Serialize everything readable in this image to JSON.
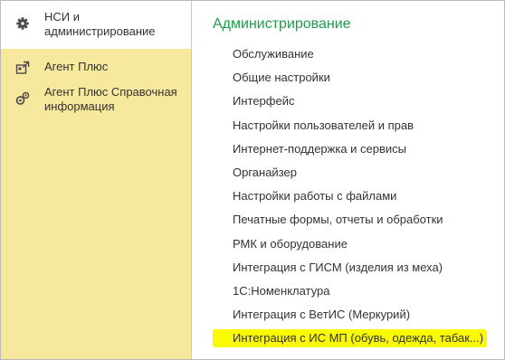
{
  "sidebar": {
    "items": [
      {
        "label": "НСИ и\nадминистрирование",
        "line1": "НСИ и",
        "line2": "администрирование",
        "icon": "gear-icon",
        "active": true
      },
      {
        "label": "Агент Плюс",
        "icon": "agent-plus-icon",
        "active": false
      },
      {
        "label": "Агент Плюс Справочная информация",
        "line1": "Агент Плюс Справочная",
        "line2": "информация",
        "icon": "agent-plus-reference-icon",
        "active": false
      }
    ]
  },
  "main": {
    "section_title": "Администрирование",
    "links": [
      {
        "label": "Обслуживание"
      },
      {
        "label": "Общие настройки"
      },
      {
        "label": "Интерфейс"
      },
      {
        "label": "Настройки пользователей и прав"
      },
      {
        "label": "Интернет-поддержка и сервисы"
      },
      {
        "label": "Органайзер"
      },
      {
        "label": "Настройки работы с файлами"
      },
      {
        "label": "Печатные формы, отчеты и обработки"
      },
      {
        "label": "РМК и оборудование"
      },
      {
        "label": "Интеграция с ГИСМ (изделия из меха)"
      },
      {
        "label": "1С:Номенклатура"
      },
      {
        "label": "Интеграция с ВетИС (Меркурий)"
      },
      {
        "label": "Интеграция с ИС МП (обувь, одежда, табак...)",
        "highlighted": true
      }
    ]
  },
  "colors": {
    "sidebar_bg": "#f6e89c",
    "active_item_bg": "#ffffff",
    "title_green": "#1f9c4a",
    "highlight_yellow": "#fafa00",
    "text": "#333333"
  }
}
